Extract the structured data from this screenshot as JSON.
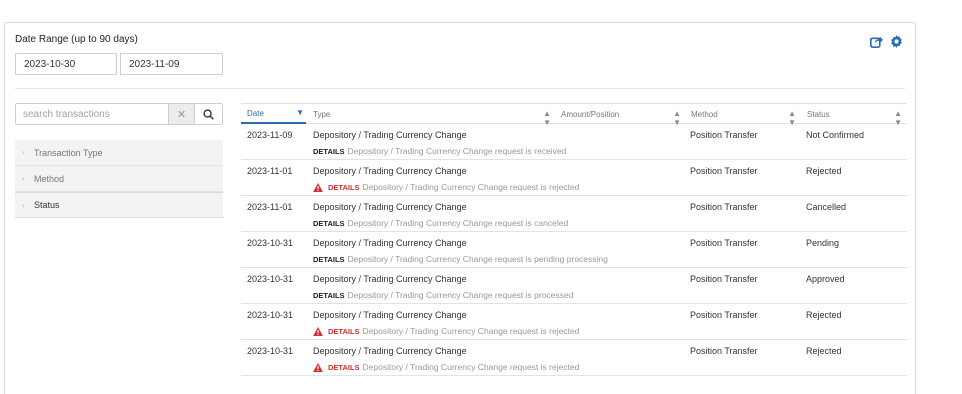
{
  "filter_panel": {
    "date_range_label": "Date Range (up to 90 days)",
    "date_from": "2023-10-30",
    "date_to": "2023-11-09"
  },
  "toolbar_icons": [
    "share-icon",
    "gear-icon"
  ],
  "search": {
    "placeholder": "search transactions",
    "clear_glyph": "✕"
  },
  "filters": [
    {
      "label": "Transaction Type"
    },
    {
      "label": "Method"
    },
    {
      "label": "Status"
    }
  ],
  "table": {
    "columns": {
      "date": "Date",
      "type": "Type",
      "amount": "Amount/Position",
      "method": "Method",
      "status": "Status"
    },
    "details_keyword": "DETAILS",
    "rows": [
      {
        "date": "2023-11-09",
        "type": "Depository / Trading Currency Change",
        "method": "Position Transfer",
        "status": "Not Confirmed",
        "details": "Depository / Trading Currency Change request is received",
        "warning": false
      },
      {
        "date": "2023-11-01",
        "type": "Depository / Trading Currency Change",
        "method": "Position Transfer",
        "status": "Rejected",
        "details": "Depository / Trading Currency Change request is rejected",
        "warning": true
      },
      {
        "date": "2023-11-01",
        "type": "Depository / Trading Currency Change",
        "method": "Position Transfer",
        "status": "Cancelled",
        "details": "Depository / Trading Currency Change request is canceled",
        "warning": false
      },
      {
        "date": "2023-10-31",
        "type": "Depository / Trading Currency Change",
        "method": "Position Transfer",
        "status": "Pending",
        "details": "Depository / Trading Currency Change request is pending processing",
        "warning": false
      },
      {
        "date": "2023-10-31",
        "type": "Depository / Trading Currency Change",
        "method": "Position Transfer",
        "status": "Approved",
        "details": "Depository / Trading Currency Change request is processed",
        "warning": false
      },
      {
        "date": "2023-10-31",
        "type": "Depository / Trading Currency Change",
        "method": "Position Transfer",
        "status": "Rejected",
        "details": "Depository / Trading Currency Change request is rejected",
        "warning": true
      },
      {
        "date": "2023-10-31",
        "type": "Depository / Trading Currency Change",
        "method": "Position Transfer",
        "status": "Rejected",
        "details": "Depository / Trading Currency Change request is rejected",
        "warning": true
      }
    ]
  },
  "colors": {
    "accent": "#2a6db5",
    "error": "#d32f2f"
  }
}
